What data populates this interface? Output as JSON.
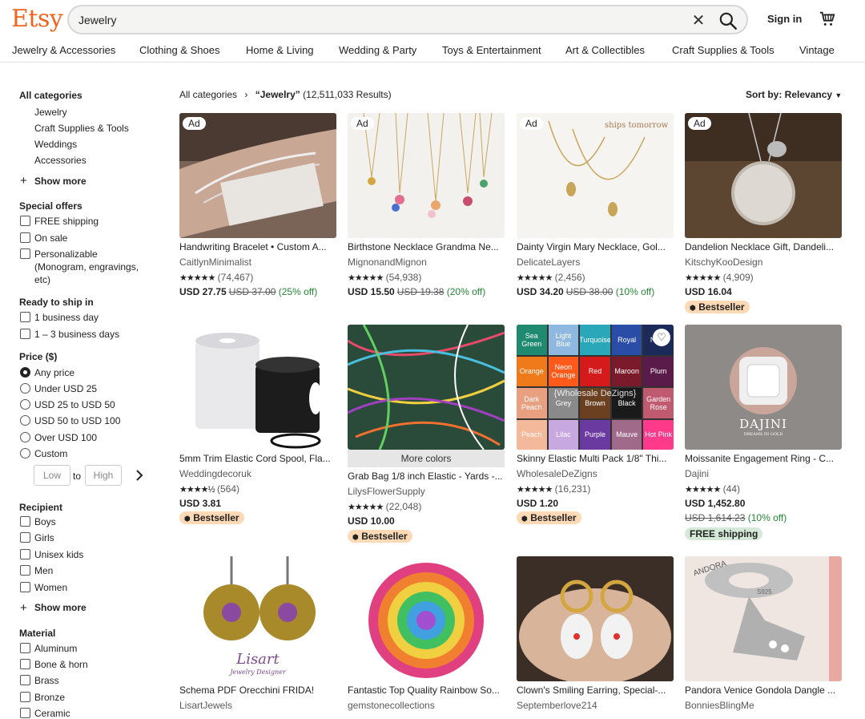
{
  "header": {
    "logo": "Etsy",
    "search_value": "Jewelry",
    "signin": "Sign in"
  },
  "nav": [
    "Jewelry & Accessories",
    "Clothing & Shoes",
    "Home & Living",
    "Wedding & Party",
    "Toys & Entertainment",
    "Art & Collectibles",
    "Craft Supplies & Tools",
    "Vintage"
  ],
  "sidebar": {
    "all_categories": "All categories",
    "categories": [
      "Jewelry",
      "Craft Supplies & Tools",
      "Weddings",
      "Accessories"
    ],
    "show_more": "Show more",
    "special_offers": "Special offers",
    "offers": [
      "FREE shipping",
      "On sale",
      "Personalizable",
      "(Monogram, engravings,",
      "etc)"
    ],
    "ready_to_ship": "Ready to ship in",
    "ship_options": [
      "1 business day",
      "1 – 3 business days"
    ],
    "price": "Price ($)",
    "price_options": [
      "Any price",
      "Under USD 25",
      "USD 25 to USD 50",
      "USD 50 to USD 100",
      "Over USD 100",
      "Custom"
    ],
    "low": "Low",
    "to": "to",
    "high": "High",
    "recipient": "Recipient",
    "recipients": [
      "Boys",
      "Girls",
      "Unisex kids",
      "Men",
      "Women"
    ],
    "show_more_2": "Show more",
    "material": "Material",
    "materials": [
      "Aluminum",
      "Bone & horn",
      "Brass",
      "Bronze",
      "Ceramic"
    ]
  },
  "results": {
    "breadcrumb_root": "All categories",
    "breadcrumb_sep": "›",
    "query": "“Jewelry”",
    "count": "(12,511,033 Results)",
    "sort": "Sort by: Relevancy"
  },
  "products": [
    {
      "ad": "Ad",
      "title": "Handwriting Bracelet • Custom A...",
      "shop": "CaitlynMinimalist",
      "stars": "★★★★★",
      "reviews": "(74,467)",
      "price": "USD 27.75",
      "orig": "USD 37.00",
      "off": "(25% off)",
      "badge": ""
    },
    {
      "ad": "Ad",
      "title": "Birthstone Necklace Grandma Ne...",
      "shop": "MignonandMignon",
      "stars": "★★★★★",
      "reviews": "(54,938)",
      "price": "USD 15.50",
      "orig": "USD 19.38",
      "off": "(20% off)",
      "badge": ""
    },
    {
      "ad": "Ad",
      "title": "Dainty Virgin Mary Necklace, Gol...",
      "shop": "DelicateLayers",
      "stars": "★★★★★",
      "reviews": "(2,456)",
      "price": "USD 34.20",
      "orig": "USD 38.00",
      "off": "(10% off)",
      "badge": "",
      "overlay": "ships tomorrow"
    },
    {
      "ad": "Ad",
      "title": "Dandelion Necklace Gift, Dandeli...",
      "shop": "KitschyKooDesign",
      "stars": "★★★★★",
      "reviews": "(4,909)",
      "price": "USD 16.04",
      "orig": "",
      "off": "",
      "badge": "Bestseller"
    },
    {
      "ad": "",
      "title": "5mm Trim Elastic Cord Spool, Fla...",
      "shop": "Weddingdecoruk",
      "stars": "★★★★½",
      "reviews": "(564)",
      "price": "USD 3.81",
      "orig": "",
      "off": "",
      "badge": "Bestseller"
    },
    {
      "ad": "",
      "title": "Grab Bag 1/8 inch Elastic - Yards -...",
      "shop": "LilysFlowerSupply",
      "stars": "★★★★★",
      "reviews": "(22,048)",
      "price": "USD 10.00",
      "orig": "",
      "off": "",
      "badge": "Bestseller",
      "more": "More colors"
    },
    {
      "ad": "",
      "title": "Skinny Elastic Multi Pack 1/8\" Thi...",
      "shop": "WholesaleDeZigns",
      "stars": "★★★★★",
      "reviews": "(16,231)",
      "price": "USD 1.20",
      "orig": "",
      "off": "",
      "badge": "Bestseller",
      "swatches": [
        "Sea Green",
        "Light Blue",
        "Turquoise",
        "Royal",
        "Navy",
        "Orange",
        "Neon Orange",
        "Red",
        "Maroon",
        "Plum",
        "Dark Peach",
        "Grey",
        "Brown",
        "Black",
        "Garden Rose",
        "Peach",
        "Lilac",
        "Purple",
        "Mauve",
        "Hot Pink"
      ],
      "overlay": "{Wholesale DeZigns}"
    },
    {
      "ad": "",
      "title": "Moissanite Engagement Ring - C...",
      "shop": "Dajini",
      "stars": "★★★★★",
      "reviews": "(44)",
      "price": "USD 1,452.80",
      "orig": "",
      "off": "",
      "badge": "",
      "price2_orig": "USD 1,614.23",
      "price2_off": "(10% off)",
      "badge2": "FREE shipping",
      "brand": "DAJINI",
      "brand_sub": "DREAMS IN GOLD"
    },
    {
      "ad": "",
      "title": "Schema PDF Orecchini FRIDA!",
      "shop": "LisartJewels",
      "brand": "Lisart",
      "brand_sub": "Jewelry Designer"
    },
    {
      "ad": "",
      "title": "Fantastic Top Quality Rainbow So...",
      "shop": "gemstonecollections"
    },
    {
      "ad": "",
      "title": "Clown's Smiling Earring, Special-...",
      "shop": "Septemberlove214"
    },
    {
      "ad": "",
      "title": "Pandora Venice Gondola Dangle ...",
      "shop": "BonniesBlingMe",
      "brand": "ANDORA",
      "brand_sub": "S925"
    }
  ],
  "colors": {
    "accent": "#f1641e",
    "bestseller_bg": "#fdd9b5",
    "free_ship_bg": "#d4e9d7",
    "sale_green": "#258635"
  }
}
